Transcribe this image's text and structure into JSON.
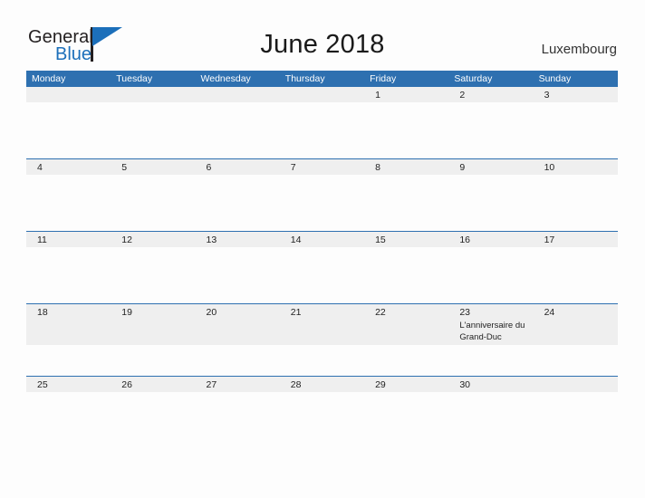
{
  "brand": {
    "name_part1": "General",
    "name_part2": "Blue",
    "flag_icon": "blue-triangle-flag"
  },
  "header": {
    "title": "June 2018",
    "location": "Luxembourg"
  },
  "colors": {
    "header_blue": "#2e70b0",
    "brand_blue": "#1c6fba",
    "day_band_gray": "#efefef",
    "page_background": "#fdfdfd",
    "text": "#222222"
  },
  "calendar": {
    "month": "June",
    "year": "2018",
    "weekday_headers": [
      "Monday",
      "Tuesday",
      "Wednesday",
      "Thursday",
      "Friday",
      "Saturday",
      "Sunday"
    ],
    "weeks": [
      {
        "has_event": false,
        "days": [
          {
            "number": "",
            "event": ""
          },
          {
            "number": "",
            "event": ""
          },
          {
            "number": "",
            "event": ""
          },
          {
            "number": "",
            "event": ""
          },
          {
            "number": "1",
            "event": ""
          },
          {
            "number": "2",
            "event": ""
          },
          {
            "number": "3",
            "event": ""
          }
        ]
      },
      {
        "has_event": false,
        "days": [
          {
            "number": "4",
            "event": ""
          },
          {
            "number": "5",
            "event": ""
          },
          {
            "number": "6",
            "event": ""
          },
          {
            "number": "7",
            "event": ""
          },
          {
            "number": "8",
            "event": ""
          },
          {
            "number": "9",
            "event": ""
          },
          {
            "number": "10",
            "event": ""
          }
        ]
      },
      {
        "has_event": false,
        "days": [
          {
            "number": "11",
            "event": ""
          },
          {
            "number": "12",
            "event": ""
          },
          {
            "number": "13",
            "event": ""
          },
          {
            "number": "14",
            "event": ""
          },
          {
            "number": "15",
            "event": ""
          },
          {
            "number": "16",
            "event": ""
          },
          {
            "number": "17",
            "event": ""
          }
        ]
      },
      {
        "has_event": true,
        "days": [
          {
            "number": "18",
            "event": ""
          },
          {
            "number": "19",
            "event": ""
          },
          {
            "number": "20",
            "event": ""
          },
          {
            "number": "21",
            "event": ""
          },
          {
            "number": "22",
            "event": ""
          },
          {
            "number": "23",
            "event": "L'anniversaire du Grand-Duc"
          },
          {
            "number": "24",
            "event": ""
          }
        ]
      },
      {
        "has_event": false,
        "days": [
          {
            "number": "25",
            "event": ""
          },
          {
            "number": "26",
            "event": ""
          },
          {
            "number": "27",
            "event": ""
          },
          {
            "number": "28",
            "event": ""
          },
          {
            "number": "29",
            "event": ""
          },
          {
            "number": "30",
            "event": ""
          },
          {
            "number": "",
            "event": ""
          }
        ]
      }
    ]
  }
}
